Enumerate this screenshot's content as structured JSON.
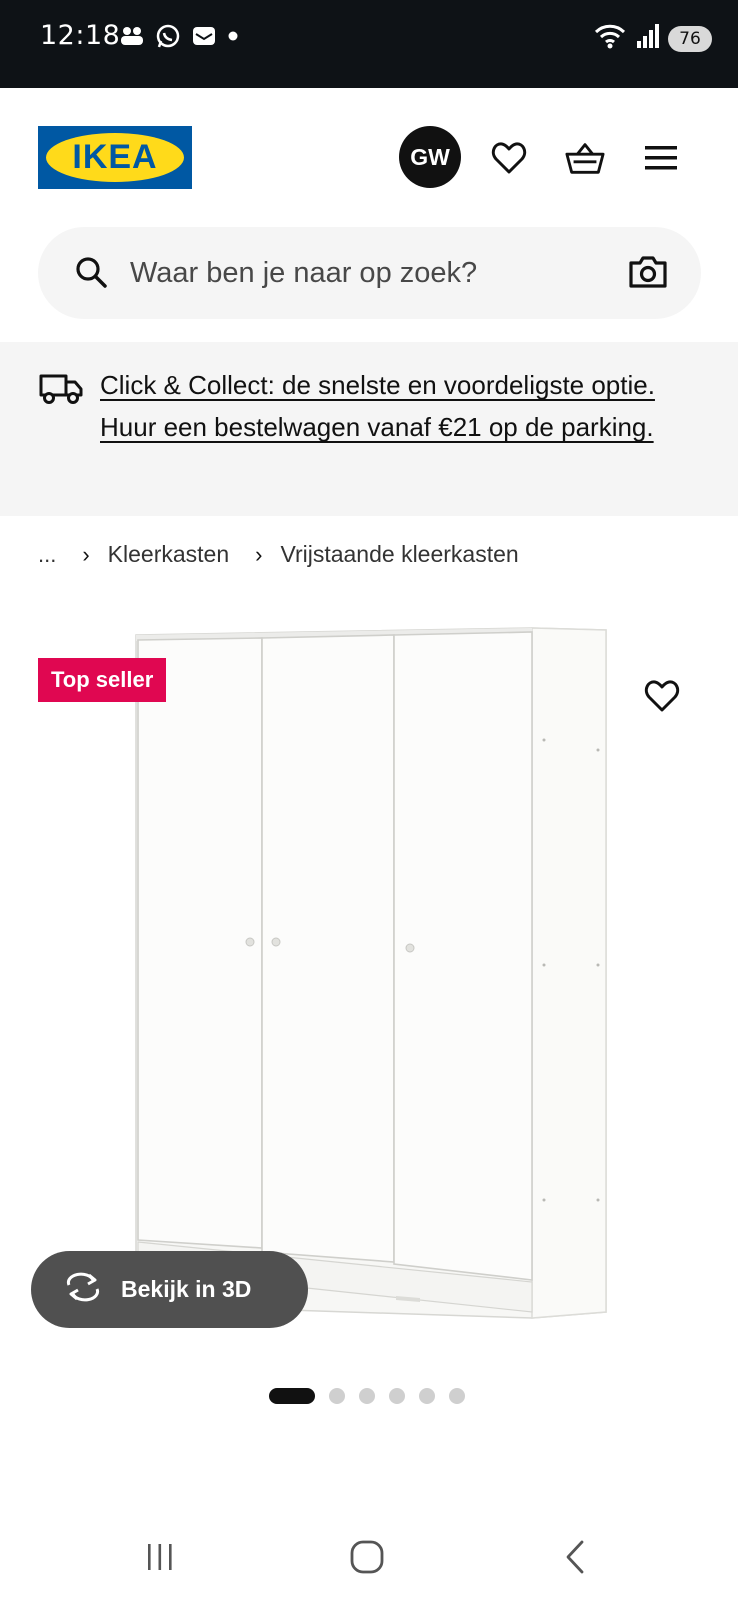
{
  "status_bar": {
    "time": "12:18",
    "battery": "76",
    "icons": [
      "teams-icon",
      "whatsapp-icon",
      "inbox-icon",
      "dot-icon",
      "wifi-icon",
      "signal-icon"
    ]
  },
  "header": {
    "logo_text": "IKEA",
    "avatar_initials": "GW",
    "colors": {
      "logo_blue": "#0058a3",
      "logo_yellow": "#ffda1a"
    }
  },
  "search": {
    "placeholder": "Waar ben je naar op zoek?"
  },
  "banner": {
    "text": "Click & Collect: de snelste en voordeligste optie. Huur een bestelwagen vanaf €21 op de parking."
  },
  "breadcrumb": {
    "ellipsis": "...",
    "items": [
      "Kleerkasten",
      "Vrijstaande kleerkasten"
    ]
  },
  "product": {
    "badge": "Top seller",
    "badge_color": "#e00751",
    "view_3d_label": "Bekijk in 3D",
    "carousel": {
      "total": 6,
      "active": 1
    }
  }
}
